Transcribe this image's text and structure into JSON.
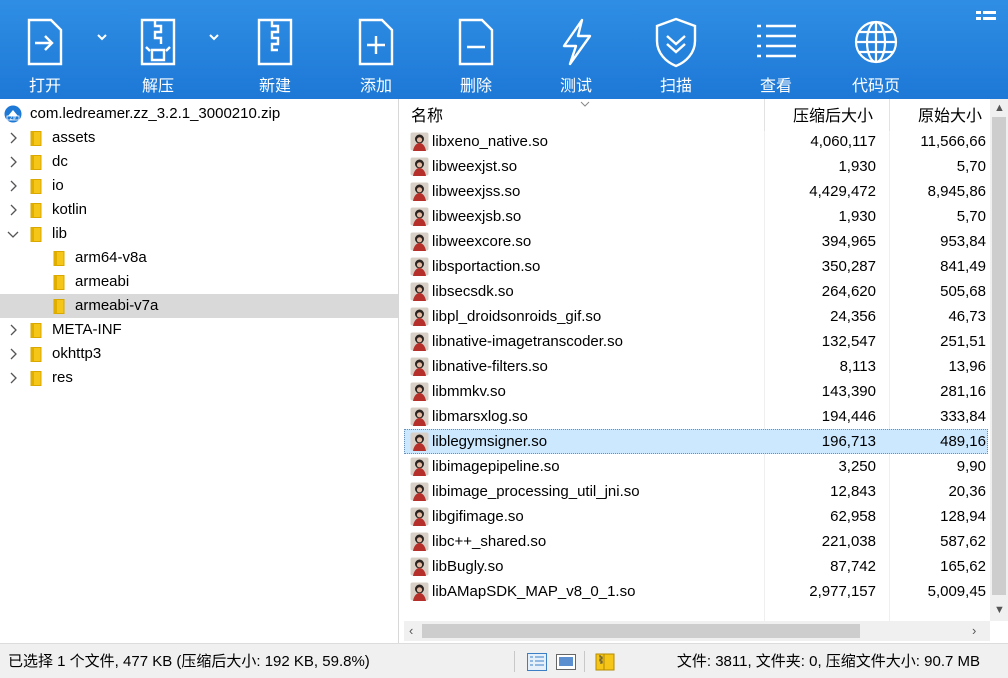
{
  "toolbar": {
    "buttons": [
      {
        "label": "打开",
        "icon": "open-icon"
      },
      {
        "label": "解压",
        "icon": "extract-icon"
      },
      {
        "label": "新建",
        "icon": "new-archive-icon"
      },
      {
        "label": "添加",
        "icon": "add-icon"
      },
      {
        "label": "删除",
        "icon": "delete-icon"
      },
      {
        "label": "测试",
        "icon": "test-icon"
      },
      {
        "label": "扫描",
        "icon": "scan-shield-icon"
      },
      {
        "label": "查看",
        "icon": "view-list-icon"
      },
      {
        "label": "代码页",
        "icon": "globe-icon"
      }
    ]
  },
  "tree": {
    "root": "com.ledreamer.zz_3.2.1_3000210.zip",
    "items": [
      {
        "label": "assets",
        "level": 1,
        "expandable": true,
        "expanded": false
      },
      {
        "label": "dc",
        "level": 1,
        "expandable": true,
        "expanded": false
      },
      {
        "label": "io",
        "level": 1,
        "expandable": true,
        "expanded": false
      },
      {
        "label": "kotlin",
        "level": 1,
        "expandable": true,
        "expanded": false
      },
      {
        "label": "lib",
        "level": 1,
        "expandable": true,
        "expanded": true
      },
      {
        "label": "arm64-v8a",
        "level": 2,
        "expandable": false,
        "expanded": false
      },
      {
        "label": "armeabi",
        "level": 2,
        "expandable": false,
        "expanded": false
      },
      {
        "label": "armeabi-v7a",
        "level": 2,
        "expandable": false,
        "expanded": false,
        "selected": true
      },
      {
        "label": "META-INF",
        "level": 1,
        "expandable": true,
        "expanded": false
      },
      {
        "label": "okhttp3",
        "level": 1,
        "expandable": true,
        "expanded": false
      },
      {
        "label": "res",
        "level": 1,
        "expandable": true,
        "expanded": false
      }
    ]
  },
  "list": {
    "columns": {
      "name": "名称",
      "compressed": "压缩后大小",
      "original": "原始大小"
    },
    "rows": [
      {
        "name": "libxeno_native.so",
        "compressed": "4,060,117",
        "original": "11,566,66"
      },
      {
        "name": "libweexjst.so",
        "compressed": "1,930",
        "original": "5,70"
      },
      {
        "name": "libweexjss.so",
        "compressed": "4,429,472",
        "original": "8,945,86"
      },
      {
        "name": "libweexjsb.so",
        "compressed": "1,930",
        "original": "5,70"
      },
      {
        "name": "libweexcore.so",
        "compressed": "394,965",
        "original": "953,84"
      },
      {
        "name": "libsportaction.so",
        "compressed": "350,287",
        "original": "841,49"
      },
      {
        "name": "libsecsdk.so",
        "compressed": "264,620",
        "original": "505,68"
      },
      {
        "name": "libpl_droidsonroids_gif.so",
        "compressed": "24,356",
        "original": "46,73"
      },
      {
        "name": "libnative-imagetranscoder.so",
        "compressed": "132,547",
        "original": "251,51"
      },
      {
        "name": "libnative-filters.so",
        "compressed": "8,113",
        "original": "13,96"
      },
      {
        "name": "libmmkv.so",
        "compressed": "143,390",
        "original": "281,16"
      },
      {
        "name": "libmarsxlog.so",
        "compressed": "194,446",
        "original": "333,84"
      },
      {
        "name": "liblegymsigner.so",
        "compressed": "196,713",
        "original": "489,16",
        "selected": true
      },
      {
        "name": "libimagepipeline.so",
        "compressed": "3,250",
        "original": "9,90"
      },
      {
        "name": "libimage_processing_util_jni.so",
        "compressed": "12,843",
        "original": "20,36"
      },
      {
        "name": "libgifimage.so",
        "compressed": "62,958",
        "original": "128,94"
      },
      {
        "name": "libc++_shared.so",
        "compressed": "221,038",
        "original": "587,62"
      },
      {
        "name": "libBugly.so",
        "compressed": "87,742",
        "original": "165,62"
      },
      {
        "name": "libAMapSDK_MAP_v8_0_1.so",
        "compressed": "2,977,157",
        "original": "5,009,45"
      }
    ]
  },
  "status": {
    "selection": "已选择 1 个文件, 477 KB (压缩后大小: 192 KB, 59.8%)",
    "summary": "文件: 3811, 文件夹: 0, 压缩文件大小: 90.7 MB"
  },
  "colors": {
    "toolbar": "#1d78d6",
    "selected_row": "#cce8ff",
    "selected_tree": "#d9d9d9",
    "folder": "#f5c518"
  }
}
